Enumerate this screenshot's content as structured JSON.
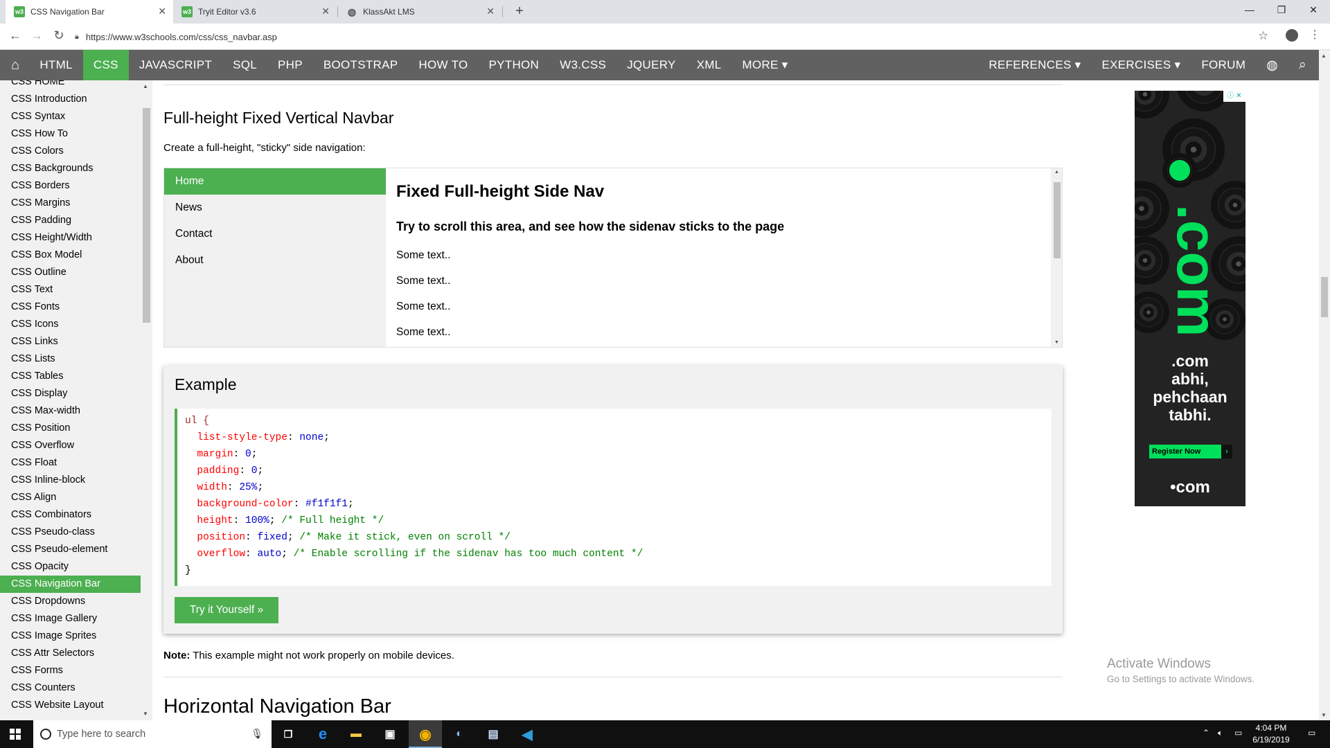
{
  "browser": {
    "tabs": [
      {
        "label": "CSS Navigation Bar",
        "active": true
      },
      {
        "label": "Tryit Editor v3.6",
        "active": false
      },
      {
        "label": "KlassAkt LMS",
        "active": false
      }
    ],
    "url": "https://www.w3schools.com/css/css_navbar.asp",
    "window_controls": {
      "minimize": "—",
      "maximize": "❐",
      "close": "✕"
    }
  },
  "w3nav": {
    "items": [
      "HTML",
      "CSS",
      "JAVASCRIPT",
      "SQL",
      "PHP",
      "BOOTSTRAP",
      "HOW TO",
      "PYTHON",
      "W3.CSS",
      "JQUERY",
      "XML",
      "MORE ▾"
    ],
    "active": "CSS",
    "right_items": [
      "REFERENCES ▾",
      "EXERCISES ▾",
      "FORUM"
    ]
  },
  "sidebar": {
    "links": [
      "CSS HOME",
      "CSS Introduction",
      "CSS Syntax",
      "CSS How To",
      "CSS Colors",
      "CSS Backgrounds",
      "CSS Borders",
      "CSS Margins",
      "CSS Padding",
      "CSS Height/Width",
      "CSS Box Model",
      "CSS Outline",
      "CSS Text",
      "CSS Fonts",
      "CSS Icons",
      "CSS Links",
      "CSS Lists",
      "CSS Tables",
      "CSS Display",
      "CSS Max-width",
      "CSS Position",
      "CSS Overflow",
      "CSS Float",
      "CSS Inline-block",
      "CSS Align",
      "CSS Combinators",
      "CSS Pseudo-class",
      "CSS Pseudo-element",
      "CSS Opacity",
      "CSS Navigation Bar",
      "CSS Dropdowns",
      "CSS Image Gallery",
      "CSS Image Sprites",
      "CSS Attr Selectors",
      "CSS Forms",
      "CSS Counters",
      "CSS Website Layout"
    ],
    "active": "CSS Navigation Bar"
  },
  "main": {
    "section_title": "Full-height Fixed Vertical Navbar",
    "intro": "Create a full-height, \"sticky\" side navigation:",
    "demo": {
      "nav_links": [
        "Home",
        "News",
        "Contact",
        "About"
      ],
      "heading": "Fixed Full-height Side Nav",
      "subheading": "Try to scroll this area, and see how the sidenav sticks to the page",
      "texts": [
        "Some text..",
        "Some text..",
        "Some text..",
        "Some text.."
      ]
    },
    "example": {
      "title": "Example",
      "code": {
        "selector": "ul {",
        "decls": [
          {
            "prop": "list-style-type",
            "value": "none",
            "comment": ""
          },
          {
            "prop": "margin",
            "value": "0",
            "comment": ""
          },
          {
            "prop": "padding",
            "value": "0",
            "comment": ""
          },
          {
            "prop": "width",
            "value": "25%",
            "comment": ""
          },
          {
            "prop": "background-color",
            "value": "#f1f1f1",
            "comment": ""
          },
          {
            "prop": "height",
            "value": "100%",
            "comment": "/* Full height */"
          },
          {
            "prop": "position",
            "value": "fixed",
            "comment": "/* Make it stick, even on scroll */"
          },
          {
            "prop": "overflow",
            "value": "auto",
            "comment": "/* Enable scrolling if the sidenav has too much content */"
          }
        ],
        "close": "}"
      },
      "button": "Try it Yourself »"
    },
    "note_label": "Note:",
    "note_text": " This example might not work properly on mobile devices.",
    "next_title": "Horizontal Navigation Bar"
  },
  "ad": {
    "big_text": ".com",
    "copy": [
      ".com",
      "abhi,",
      "pehchaan",
      "tabhi."
    ],
    "button": "Register Now",
    "logo": "•com",
    "close_label": "ⓘ ✕"
  },
  "watermark": {
    "title": "Activate Windows",
    "subtitle": "Go to Settings to activate Windows."
  },
  "taskbar": {
    "search_placeholder": "Type here to search",
    "time": "4:04 PM",
    "date": "6/19/2019"
  },
  "colors": {
    "accent": "#4caf50",
    "nav_bg": "#616161",
    "sidebar_bg": "#f1f1f1"
  }
}
